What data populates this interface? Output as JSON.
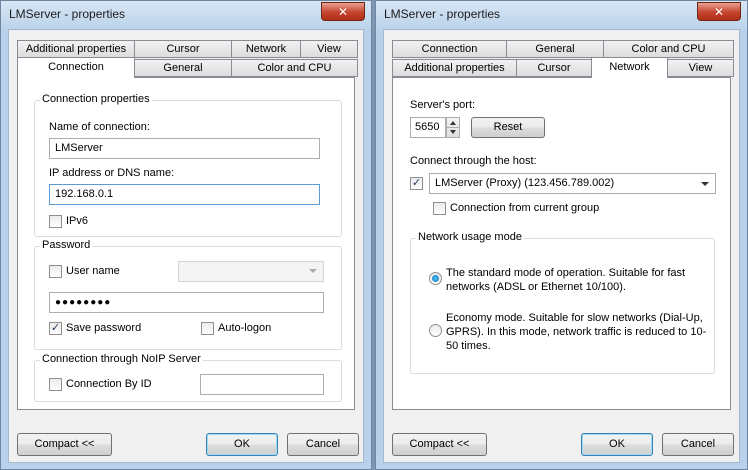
{
  "left": {
    "title": "LMServer - properties",
    "close_glyph": "✕",
    "tabs_row1": [
      "Additional properties",
      "Cursor",
      "Network",
      "View"
    ],
    "tabs_row2": [
      "Connection",
      "General",
      "Color and CPU"
    ],
    "selected_tab": "Connection",
    "conn_props": {
      "title": "Connection properties",
      "name_label": "Name of connection:",
      "name_value": "LMServer",
      "ip_label": "IP address or DNS name:",
      "ip_value": "192.168.0.1",
      "ipv6_label": "IPv6",
      "ipv6_checked": false
    },
    "password": {
      "title": "Password",
      "username_label": "User name",
      "username_checked": false,
      "password_value": "●●●●●●●●",
      "save_label": "Save password",
      "save_checked": true,
      "autologon_label": "Auto-logon",
      "autologon_checked": false
    },
    "noip": {
      "title": "Connection through NoIP Server",
      "byid_label": "Connection By ID",
      "byid_checked": false,
      "id_value": ""
    },
    "compact_label": "Compact <<",
    "ok_label": "OK",
    "cancel_label": "Cancel"
  },
  "right": {
    "title": "LMServer - properties",
    "close_glyph": "✕",
    "tabs_row1": [
      "Connection",
      "General",
      "Color and CPU"
    ],
    "tabs_row2": [
      "Additional properties",
      "Cursor",
      "Network",
      "View"
    ],
    "selected_tab": "Network",
    "port_label": "Server's port:",
    "port_value": "5650",
    "reset_label": "Reset",
    "host_label": "Connect through the host:",
    "host_checked": true,
    "host_value": "LMServer (Proxy) (123.456.789.002)",
    "current_group_label": "Connection from current group",
    "current_group_checked": false,
    "usage": {
      "title": "Network usage mode",
      "standard_text": "The standard mode of operation. Suitable for fast networks (ADSL or Ethernet 10/100).",
      "standard_selected": true,
      "economy_text": "Economy mode. Suitable for slow networks (Dial-Up, GPRS). In this mode, network traffic is reduced to 10-50 times.",
      "economy_selected": false
    },
    "compact_label": "Compact <<",
    "ok_label": "OK",
    "cancel_label": "Cancel"
  },
  "check_glyph": "✓",
  "colors": {
    "titlebar": "#bcd3ea",
    "dialog_bg": "#f0f0f0",
    "focus_border": "#5b9bd5",
    "close_red": "#c4442e"
  }
}
